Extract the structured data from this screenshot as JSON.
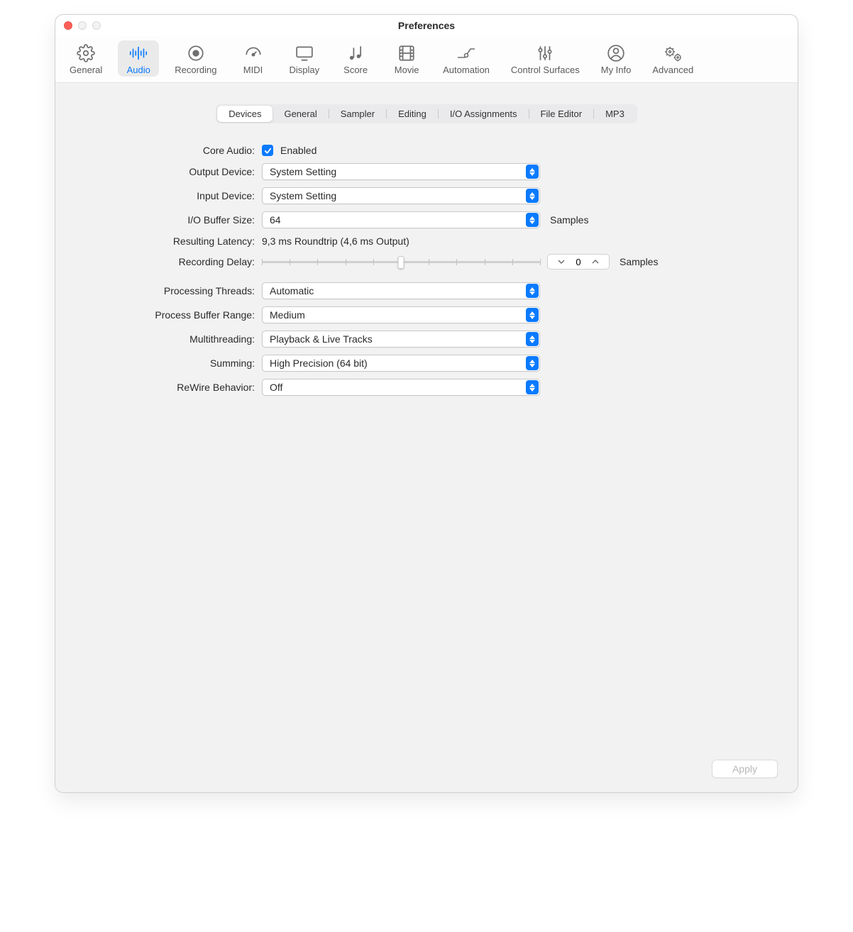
{
  "window": {
    "title": "Preferences"
  },
  "toolbar": {
    "items": [
      {
        "label": "General",
        "icon": "gear"
      },
      {
        "label": "Audio",
        "icon": "audio-wave",
        "selected": true
      },
      {
        "label": "Recording",
        "icon": "record"
      },
      {
        "label": "MIDI",
        "icon": "midi-gauge"
      },
      {
        "label": "Display",
        "icon": "display"
      },
      {
        "label": "Score",
        "icon": "score-notes"
      },
      {
        "label": "Movie",
        "icon": "film"
      },
      {
        "label": "Automation",
        "icon": "automation-node"
      },
      {
        "label": "Control Surfaces",
        "icon": "sliders"
      },
      {
        "label": "My Info",
        "icon": "person"
      },
      {
        "label": "Advanced",
        "icon": "gears"
      }
    ]
  },
  "tabs": {
    "items": [
      "Devices",
      "General",
      "Sampler",
      "Editing",
      "I/O Assignments",
      "File Editor",
      "MP3"
    ],
    "active": "Devices"
  },
  "form": {
    "core_audio": {
      "label": "Core Audio:",
      "checkbox_label": "Enabled",
      "checked": true
    },
    "output_device": {
      "label": "Output Device:",
      "value": "System Setting"
    },
    "input_device": {
      "label": "Input Device:",
      "value": "System Setting"
    },
    "io_buffer": {
      "label": "I/O Buffer Size:",
      "value": "64",
      "suffix": "Samples"
    },
    "latency": {
      "label": "Resulting Latency:",
      "value": "9,3 ms Roundtrip (4,6 ms Output)"
    },
    "recording_delay": {
      "label": "Recording Delay:",
      "value": "0",
      "suffix": "Samples"
    },
    "proc_threads": {
      "label": "Processing Threads:",
      "value": "Automatic"
    },
    "proc_buffer": {
      "label": "Process Buffer Range:",
      "value": "Medium"
    },
    "multithreading": {
      "label": "Multithreading:",
      "value": "Playback & Live Tracks"
    },
    "summing": {
      "label": "Summing:",
      "value": "High Precision (64 bit)"
    },
    "rewire": {
      "label": "ReWire Behavior:",
      "value": "Off"
    }
  },
  "apply": {
    "label": "Apply"
  }
}
